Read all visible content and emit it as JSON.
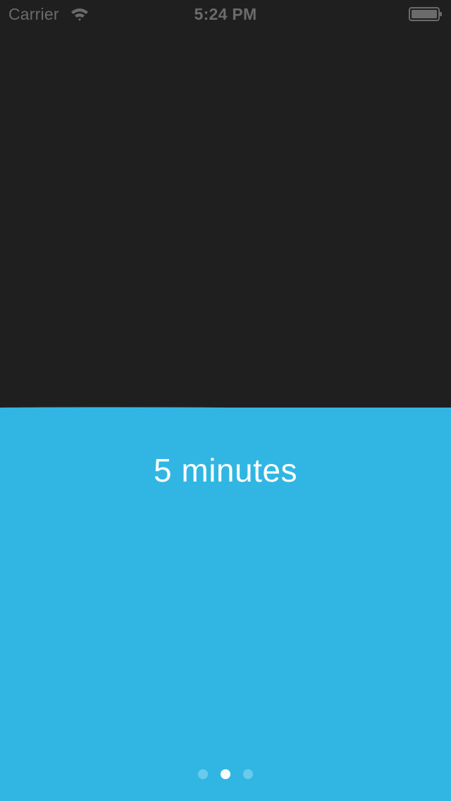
{
  "status_bar": {
    "carrier": "Carrier",
    "time": "5:24 PM",
    "wifi_icon": "wifi-icon",
    "battery_icon": "battery-icon",
    "text_color": "#6b6b6b"
  },
  "main": {
    "background_color": "#1f1f1f",
    "fill_color": "#31b6e4",
    "fill_level_fraction": 0.49,
    "duration_label": "5 minutes"
  },
  "page_control": {
    "page_count": 3,
    "current_page": 2
  }
}
